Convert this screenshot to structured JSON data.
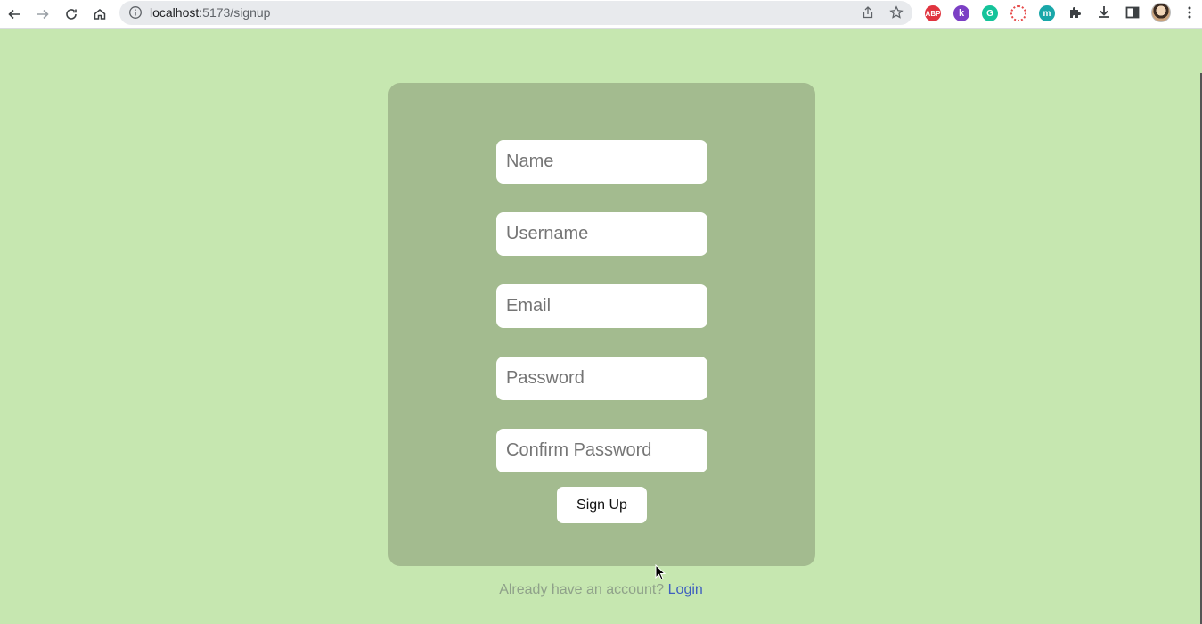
{
  "browser": {
    "url_host": "localhost",
    "url_path": ":5173/signup",
    "extensions": [
      {
        "name": "adblock-plus-icon",
        "label": "ABP",
        "color": "#e0343f"
      },
      {
        "name": "klarna-k-icon",
        "label": "k",
        "color": "#7b3fc4"
      },
      {
        "name": "grammarly-icon",
        "label": "G",
        "color": "#15c39a"
      },
      {
        "name": "dotted-circle-ext-icon",
        "label": "",
        "color": "#e64a4a"
      },
      {
        "name": "m-extension-icon",
        "label": "m",
        "color": "#19a7a9"
      }
    ]
  },
  "form": {
    "name_placeholder": "Name",
    "username_placeholder": "Username",
    "email_placeholder": "Email",
    "password_placeholder": "Password",
    "confirm_password_placeholder": "Confirm Password",
    "submit_label": "Sign Up"
  },
  "footer": {
    "prompt": "Already have an account?",
    "login_label": "Login"
  },
  "colors": {
    "page_bg": "#c6e7b0",
    "card_bg": "#a3bb8f",
    "link": "#3f5fbf"
  }
}
